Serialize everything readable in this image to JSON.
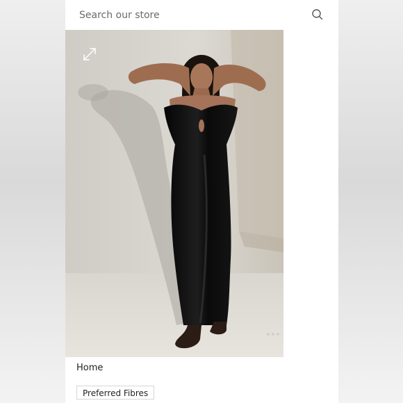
{
  "search": {
    "placeholder": "Search our store",
    "icon": "search-icon"
  },
  "product_image": {
    "icons": {
      "expand": "expand-icon"
    },
    "carousel": {
      "dot_count": 3,
      "active_index": 0
    }
  },
  "breadcrumb": {
    "home_label": "Home"
  },
  "filter_chip": {
    "label": "Preferred Fibres"
  },
  "colors": {
    "page_bg": "#e6e6e6",
    "frame_bg": "#ffffff",
    "text": "#222222",
    "dress": "#0d0d0d"
  }
}
